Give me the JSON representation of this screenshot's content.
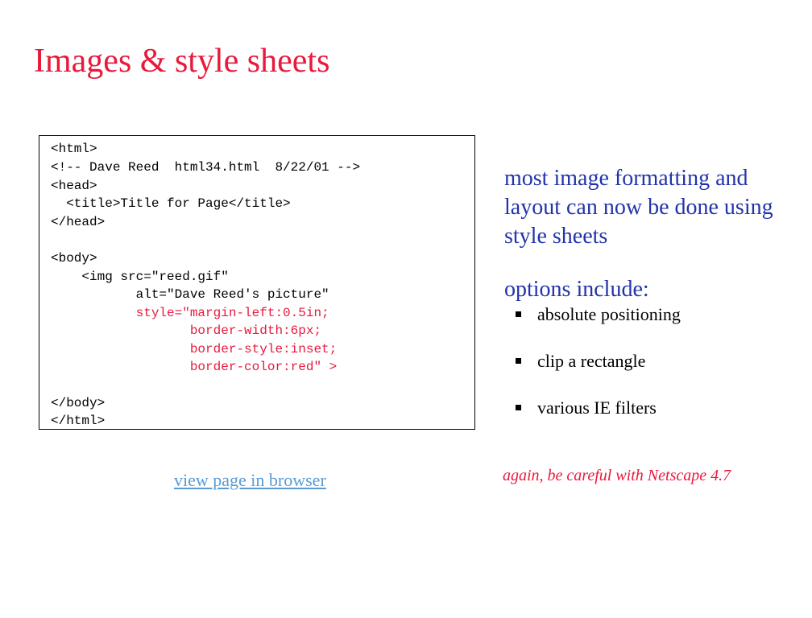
{
  "slide": {
    "title": "Images & style sheets",
    "code_lines": [
      {
        "text": "<html>",
        "color": "#000000"
      },
      {
        "text": "<!-- Dave Reed  html34.html  8/22/01 -->",
        "color": "#000000"
      },
      {
        "text": "<head>",
        "color": "#000000"
      },
      {
        "text": "  <title>Title for Page</title>",
        "color": "#000000"
      },
      {
        "text": "</head>",
        "color": "#000000"
      },
      {
        "text": "",
        "color": "#000000"
      },
      {
        "text": "<body>",
        "color": "#000000"
      },
      {
        "text": "    <img src=\"reed.gif\"",
        "color": "#000000"
      },
      {
        "text": "           alt=\"Dave Reed's picture\"",
        "color": "#000000"
      },
      {
        "text": "           style=\"margin-left:0.5in;",
        "color": "#e8193c"
      },
      {
        "text": "                  border-width:6px;",
        "color": "#e8193c"
      },
      {
        "text": "                  border-style:inset;",
        "color": "#e8193c"
      },
      {
        "text": "                  border-color:red\" >",
        "color": "#e8193c"
      },
      {
        "text": "",
        "color": "#000000"
      },
      {
        "text": "</body>",
        "color": "#000000"
      },
      {
        "text": "</html>",
        "color": "#000000"
      }
    ],
    "link_label": "view page in browser",
    "description": "most image formatting and layout can now be done using style sheets",
    "options_heading": "options include:",
    "bullets": [
      "absolute positioning",
      "clip a rectangle",
      "various IE filters"
    ],
    "note": "again, be careful with Netscape 4.7"
  },
  "colors": {
    "title": "#e8193c",
    "highlight": "#e8193c",
    "body_text": "#2233aa",
    "link": "#5b9bd5"
  }
}
